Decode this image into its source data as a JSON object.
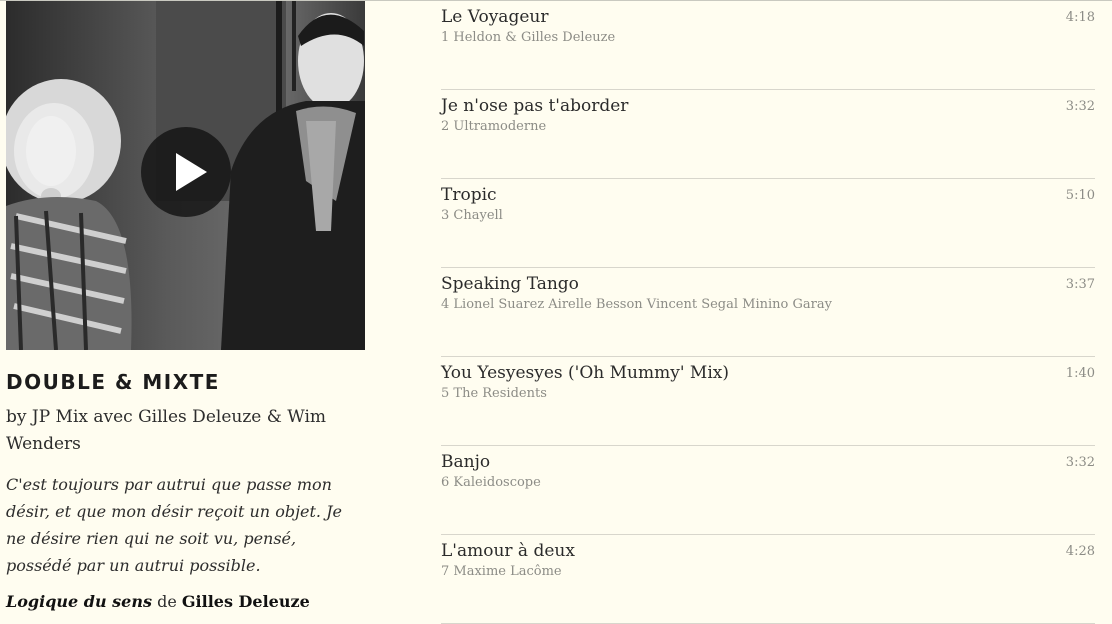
{
  "album": {
    "title": "DOUBLE & MIXTE",
    "byline": "by JP Mix avec Gilles Deleuze & Wim Wenders",
    "quote": "C'est toujours par autrui que passe mon désir, et que mon désir reçoit un objet. Je ne désire rien qui ne soit vu, pensé, possédé par un autrui possible.",
    "source_book": "Logique du sens",
    "source_de": "de",
    "source_author": "Gilles Deleuze"
  },
  "tracks": [
    {
      "title": "Le Voyageur",
      "subtitle": "1 Heldon & Gilles Deleuze",
      "duration": "4:18"
    },
    {
      "title": "Je n'ose pas t'aborder",
      "subtitle": "2 Ultramoderne",
      "duration": "3:32"
    },
    {
      "title": "Tropic",
      "subtitle": "3 Chayell",
      "duration": "5:10"
    },
    {
      "title": "Speaking Tango",
      "subtitle": "4 Lionel Suarez Airelle Besson Vincent Segal Minino Garay",
      "duration": "3:37"
    },
    {
      "title": "You Yesyesyes ('Oh Mummy' Mix)",
      "subtitle": "5 The Residents",
      "duration": "1:40"
    },
    {
      "title": "Banjo",
      "subtitle": "6 Kaleidoscope",
      "duration": "3:32"
    },
    {
      "title": "L'amour à deux",
      "subtitle": "7 Maxime Lacôme",
      "duration": "4:28"
    }
  ]
}
